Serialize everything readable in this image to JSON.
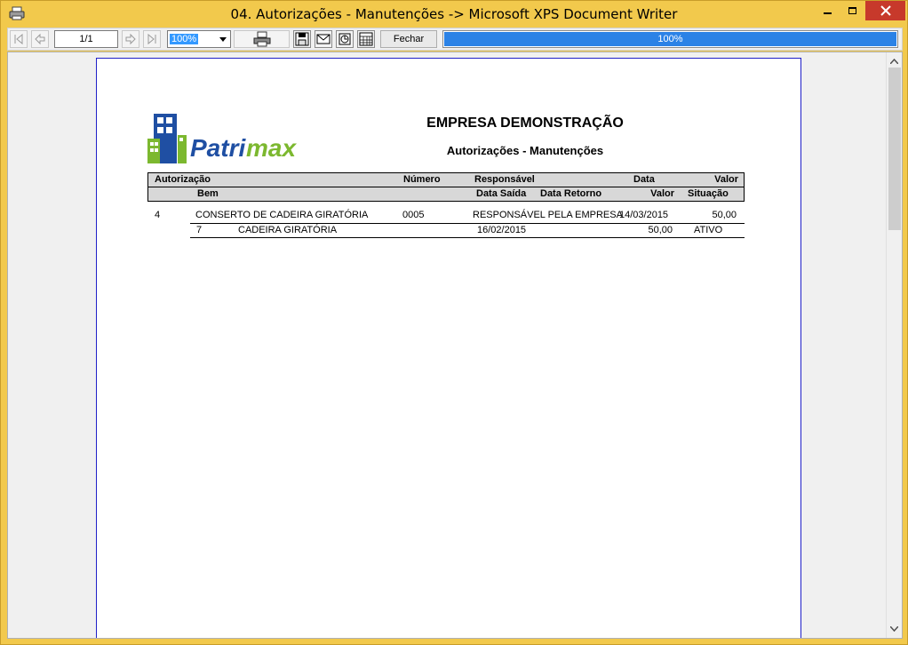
{
  "window": {
    "title": "04. Autorizações - Manutenções -> Microsoft XPS Document Writer"
  },
  "toolbar": {
    "page_indicator": "1/1",
    "zoom": "100%",
    "close_label": "Fechar",
    "progress_text": "100%",
    "progress_value": 1.0
  },
  "report": {
    "logo_text_a": "Patri",
    "logo_text_b": "max",
    "company": "EMPRESA DEMONSTRAÇÃO",
    "title": "Autorizações - Manutenções",
    "header": {
      "autorizacao": "Autorização",
      "numero": "Número",
      "responsavel": "Responsável",
      "data": "Data",
      "valor": "Valor",
      "bem": "Bem",
      "data_saida": "Data Saída",
      "data_retorno": "Data Retorno",
      "valor2": "Valor",
      "situacao": "Situação"
    },
    "rows": [
      {
        "autorizacao": "4",
        "descricao": "CONSERTO DE CADEIRA GIRATÓRIA",
        "numero": "0005",
        "responsavel": "RESPONSÁVEL PELA EMPRESA",
        "data": "14/03/2015",
        "valor": "50,00",
        "itens": [
          {
            "codigo": "7",
            "bem": "CADEIRA GIRATÓRIA",
            "data_saida": "16/02/2015",
            "valor": "50,00",
            "situacao": "ATIVO"
          }
        ]
      }
    ]
  },
  "colors": {
    "window_frame": "#f2c94c",
    "close_button": "#c7392b",
    "progress": "#2b82e6",
    "page_border": "#2020c8",
    "logo_blue": "#1f4fa3",
    "logo_green": "#7cb82f"
  }
}
